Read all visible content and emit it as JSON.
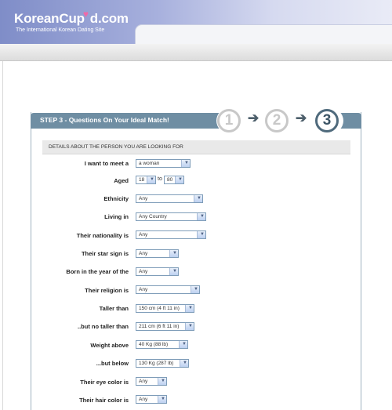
{
  "site": {
    "logo_pre": "KoreanCup",
    "logo_heart": "♥",
    "logo_post": "d.com",
    "tagline": "The International Korean Dating Site"
  },
  "step": {
    "title": "STEP 3 - Questions On Your Ideal Match!",
    "circles": [
      "1",
      "2",
      "3"
    ],
    "active_step": 3,
    "arrow": "➔"
  },
  "section": {
    "heading": "DETAILS ABOUT THE PERSON YOU ARE LOOKING FOR"
  },
  "form": {
    "meet": {
      "label": "I want to meet a",
      "value": "a woman"
    },
    "aged": {
      "label": "Aged",
      "from": "18",
      "separator": "to",
      "to": "80"
    },
    "ethnicity": {
      "label": "Ethnicity",
      "value": "Any"
    },
    "living_in": {
      "label": "Living in",
      "value": "Any Country"
    },
    "nationality": {
      "label": "Their nationality is",
      "value": "Any"
    },
    "star_sign": {
      "label": "Their star sign is",
      "value": "Any"
    },
    "born_year": {
      "label": "Born in the year of the",
      "value": "Any"
    },
    "religion": {
      "label": "Their religion is",
      "value": "Any"
    },
    "taller_than": {
      "label": "Taller than",
      "value": "150 cm (4 ft 11 in)"
    },
    "no_taller": {
      "label": "..but no taller than",
      "value": "211 cm (6 ft 11 in)"
    },
    "weight_above": {
      "label": "Weight above",
      "value": "40 Kg (88 lb)"
    },
    "weight_below": {
      "label": "...but below",
      "value": "130 Kg (287 lb)"
    },
    "eye_color": {
      "label": "Their eye color is",
      "value": "Any"
    },
    "hair_color": {
      "label": "Their hair color is",
      "value": "Any"
    }
  },
  "icons": {
    "dropdown": "chevron-down-icon",
    "glyph": "▼"
  },
  "colors": {
    "header": "#8a97d0",
    "step_bar": "#6f8ea3",
    "accent_pink": "#f06aa8"
  }
}
